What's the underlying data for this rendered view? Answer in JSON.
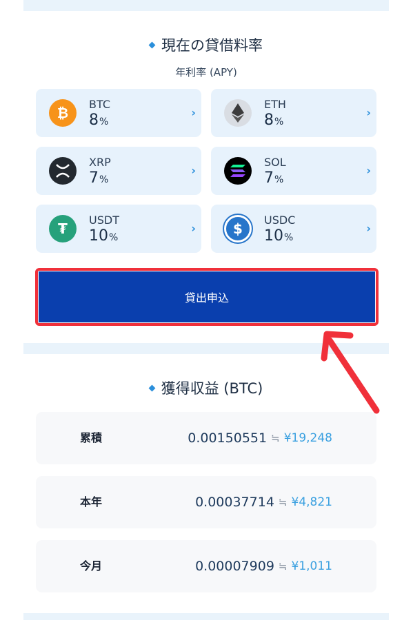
{
  "rates": {
    "title": "現在の貸借料率",
    "subtitle": "年利率 (APY)",
    "coins": [
      {
        "symbol": "BTC",
        "rate": "8",
        "unit": "%",
        "icon": "bitcoin-icon",
        "color": "#f7931a",
        "glyph": "₿"
      },
      {
        "symbol": "ETH",
        "rate": "8",
        "unit": "%",
        "icon": "ethereum-icon",
        "color": "#d9dde3",
        "glyph": "◆"
      },
      {
        "symbol": "XRP",
        "rate": "7",
        "unit": "%",
        "icon": "xrp-icon",
        "color": "#23292f",
        "glyph": "✕"
      },
      {
        "symbol": "SOL",
        "rate": "7",
        "unit": "%",
        "icon": "solana-icon",
        "color": "#000000",
        "glyph": "≡"
      },
      {
        "symbol": "USDT",
        "rate": "10",
        "unit": "%",
        "icon": "tether-icon",
        "color": "#26a17b",
        "glyph": "₮"
      },
      {
        "symbol": "USDC",
        "rate": "10",
        "unit": "%",
        "icon": "usdc-icon",
        "color": "#2775ca",
        "glyph": "$"
      }
    ],
    "chevron": "›",
    "apply_label": "貸出申込"
  },
  "earnings": {
    "title": "獲得収益 (BTC)",
    "approx_symbol": "≒",
    "rows": [
      {
        "label": "累積",
        "btc": "0.00150551",
        "jpy": "¥19,248"
      },
      {
        "label": "本年",
        "btc": "0.00037714",
        "jpy": "¥4,821"
      },
      {
        "label": "今月",
        "btc": "0.00007909",
        "jpy": "¥1,011"
      }
    ]
  },
  "colors": {
    "accent": "#2b8fdb",
    "button": "#0a3fae",
    "highlight": "#f0303a"
  }
}
